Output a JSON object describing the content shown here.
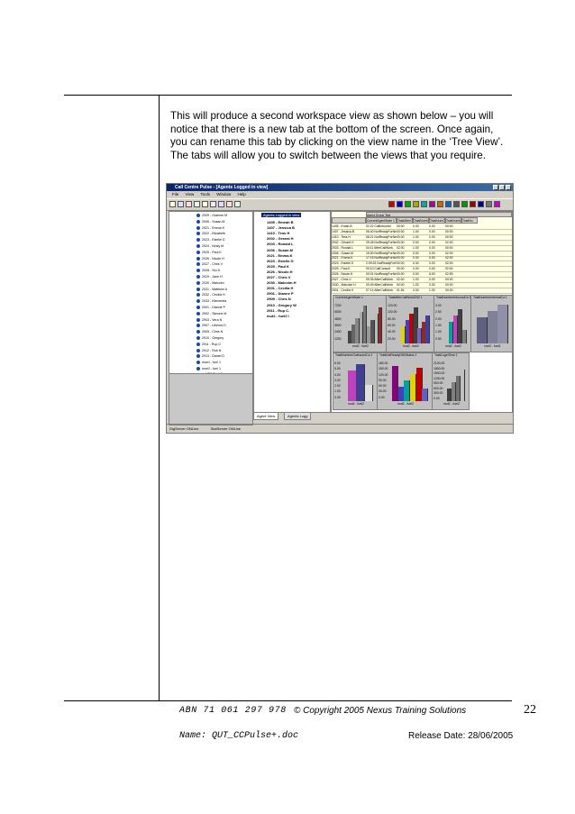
{
  "body_text": [
    "This will produce a second workspace view as shown below – you will",
    "notice that there is a new tab at the bottom of the screen.  Once again,",
    "you can rename this tab by clicking on the view name in the ‘Tree View’.",
    "The tabs will allow you to switch between the views that you require."
  ],
  "screenshot": {
    "title": "Call Centre Pulse - [Agents Logged in view]",
    "menu": [
      "File",
      "View",
      "Tools",
      "Window",
      "Help"
    ],
    "left_agents": [
      "2009 - Graeme M",
      "2006 - Susan.M",
      "2021 - Emma K",
      "2022 - Elizabeth",
      "2023 - Estelle D",
      "2024 - Kirsty M",
      "2025 - Paul K",
      "2026 - Nicole H",
      "2027 - Chris V",
      "2028 - Stu D",
      "2029 - Jane H",
      "2030 - Malcolm",
      "2031 - Matthew A",
      "2032 - Cecilia H",
      "2033 - Klementia",
      "2001 - Dianne P",
      "2902 - Simone M",
      "2903 - Vera N",
      "2907 - Liberna D",
      "2909 - Chris N",
      "2910 - Gregory",
      "2911 - Rup C",
      "2912 - Rob N",
      "2913 - Daniel D",
      "mue1 - fuel 1",
      "mue2 - fuel 1"
    ],
    "left_footer_label": "NEC Test Group",
    "tree_header": "Agents Logged in view",
    "tree_items": [
      "1405 - Emeah B",
      "1407 - Jessica B",
      "1410 - Tess H",
      "2002 - Gerard H",
      "2003 - Ronald L",
      "2006 - Susan.M",
      "2021 - Emma.K",
      "2023 - Estelle.G",
      "2025 - Paul K",
      "2026 - Nicole.H",
      "2027 - Chris V",
      "2030 - Malcolm.H",
      "2001 - Cecilia H",
      "2901 - Dianne P",
      "2909 - Chris N",
      "2910 - Gregory W",
      "2911 - Rup C.",
      "mut2 - fuel2 I"
    ],
    "table": {
      "group_header": "Agent Group Test",
      "columns": [
        "",
        "CurrentAgentState 1",
        "TotalAfterC",
        "TotalNumIn",
        "TotalNumO",
        "TotalNumIn",
        "TotalNu"
      ],
      "rows": [
        [
          "1405 - Emah.B",
          "02:22 CallInbound",
          "00:00",
          "0.00",
          "0.00",
          "00:00"
        ],
        [
          "1407 - Jessica.B",
          "06:40 NotReadyForNextCall",
          "00:00",
          "1.00",
          "0.00",
          "00:00"
        ],
        [
          "1410 - Tess H",
          "08:21 NotReadyForNextCall",
          "00:00",
          "1.00",
          "0.00",
          "00:00"
        ],
        [
          "2002 - Gerard H",
          "29:45 NotReadyForNextCa",
          "00:00",
          "0.00",
          "0.00",
          "02:00"
        ],
        [
          "2003 - Ronald L",
          "04:11 AfterCallWork",
          "02:00",
          "1.00",
          "0.00",
          "00:00"
        ],
        [
          "2006 - Susan.M",
          "15:00 NotReadyForNextCa",
          "00:00",
          "0.00",
          "0.00",
          "02:00"
        ],
        [
          "2021 - Emma K",
          "17:15 NotReadyForNextCa",
          "00:00",
          "0.00",
          "0.00",
          "02:00"
        ],
        [
          "2023 - Estelle D",
          "2:09:33 NotReadyForNext",
          "00:00",
          "0.00",
          "0.00",
          "02:00"
        ],
        [
          "2025 - Paul K",
          "00:10 CallConsult",
          "00:00",
          "0.00",
          "0.00",
          "02:00"
        ],
        [
          "2026 - Nicole.H",
          "00:01 NotReadyForNextCa",
          "00:00",
          "0.00",
          "6.00",
          "02:59"
        ],
        [
          "2027 - Chris V",
          "05:35 AfterCallWork",
          "02:00",
          "1.00",
          "0.00",
          "00:00"
        ],
        [
          "2030 - Malcolm H",
          "00:49 AfterCallWork",
          "00:00",
          "1.00",
          "0.00",
          "00:00"
        ],
        [
          "2001 - Cecilia H",
          "07:14 AfterCallWork",
          "01:54",
          "0.00",
          "1.00",
          "00:00"
        ]
      ]
    },
    "chart_panels": [
      {
        "title": "CurrentAgentState 1",
        "ticks": [
          "7200",
          "6000",
          "4800",
          "3600",
          "2400",
          "1200"
        ],
        "label": "mut2 - fuel2"
      },
      {
        "title": "TotalAfterCallWorkDN0 1",
        "ticks": [
          "120.00",
          "100.00",
          "80.00",
          "60.00",
          "40.00",
          "20.00"
        ],
        "label": "mut2 - fuel2"
      },
      {
        "title": "TotalNumberInboundCa 1",
        "ticks": [
          "3.00",
          "2.50",
          "2.00",
          "1.50",
          "1.00",
          "0.50"
        ],
        "label": "mut2 - fuel2"
      },
      {
        "title": "TotalNumberInternalCa 1",
        "ticks": [],
        "label": "mut2 - fuel2"
      },
      {
        "title": "TotalNumberOutboundCa 1",
        "ticks": [
          "6.00",
          "5.00",
          "4.00",
          "3.00",
          "2.00",
          "1.00",
          "0.00"
        ],
        "label": "mut2 - fuel2"
      },
      {
        "title": "TotalNotReadyDN0Status 1",
        "ticks": [
          "180.00",
          "150.00",
          "120.00",
          "90.00",
          "60.00",
          "30.00",
          "0.00"
        ],
        "label": "mut2 - fuel2"
      },
      {
        "title": "TotalLoginTime 1",
        "ticks": [
          "2100.00",
          "1800.00",
          "1500.00",
          "1200.00",
          "900.00",
          "600.00",
          "300.00",
          "0.00"
        ],
        "label": "mut2 - fuel2"
      }
    ],
    "tabs": [
      "Agent View",
      "Agents Logg"
    ],
    "status": [
      "DigServer ONLine",
      "StatServer ONLine"
    ]
  },
  "footer": {
    "abn": "ABN 71 061 297 978",
    "copyright": "© Copyright 2005 Nexus Training Solutions",
    "page": "22",
    "name": "Name: QUT_CCPulse+.doc",
    "release": "Release Date: 28/06/2005"
  }
}
